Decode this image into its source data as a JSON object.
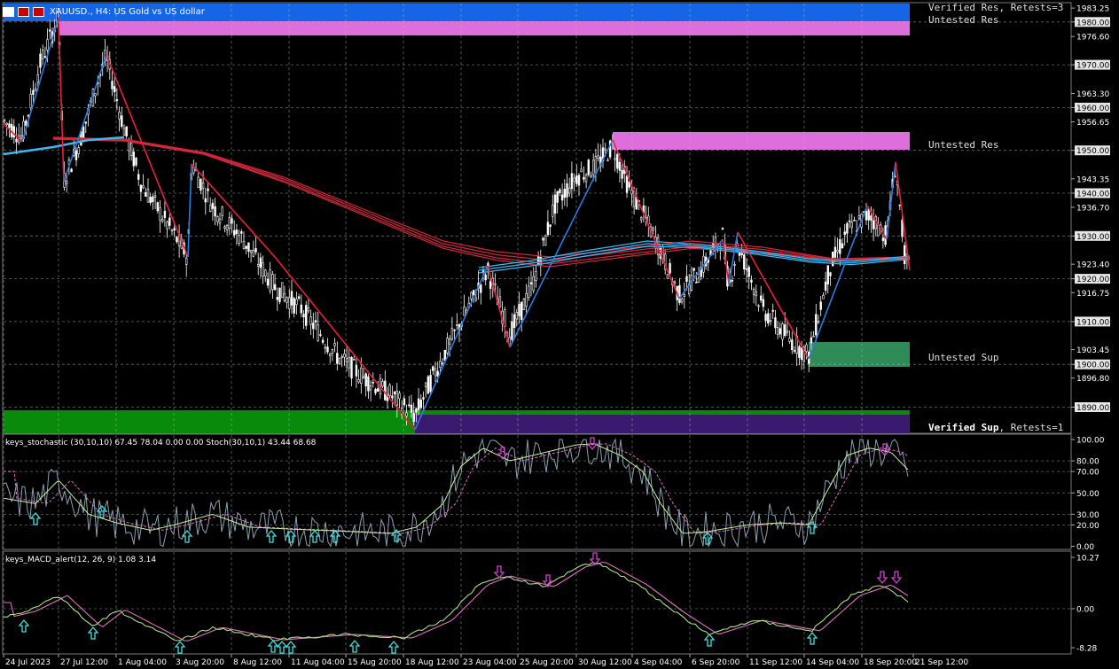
{
  "chart_header": {
    "symbol": "XAUUSD.",
    "timeframe": "H4",
    "description": "US Gold vs US dollar"
  },
  "zones": {
    "verified_res": "Verified Res, Retests=3",
    "untested_res_top": "Untested Res",
    "untested_res_mid": "Untested Res",
    "untested_sup": "Untested Sup",
    "verified_sup_bold": "Verified Sup",
    "verified_sup_rest": ", Retests=1"
  },
  "price_axis": [
    "1983.25",
    "1980.00",
    "1976.60",
    "1970.00",
    "1963.30",
    "1960.00",
    "1956.65",
    "1950.00",
    "1943.35",
    "1940.00",
    "1936.70",
    "1930.00",
    "1923.40",
    "1920.00",
    "1916.75",
    "1910.00",
    "1903.45",
    "1900.00",
    "1896.80",
    "1890.00"
  ],
  "highlighted_prices": [
    "1980.00",
    "1970.00",
    "1960.00",
    "1950.00",
    "1940.00",
    "1930.00",
    "1920.00",
    "1910.00",
    "1900.00",
    "1890.00"
  ],
  "stoch_panel": {
    "label": "keys_stochastic (30,10,10) 67.45 78.04 0.00 0.00 Stoch(30,10,1) 43.44 68.68",
    "axis": [
      "100.00",
      "80.00",
      "70.00",
      "50.00",
      "30.00",
      "20.00",
      "0.00"
    ]
  },
  "macd_panel": {
    "label": "keys_MACD_alert(12, 26, 9) 1.08 3.14",
    "axis": [
      "10.27",
      "0.00",
      "-8.28"
    ]
  },
  "time_axis": [
    "24 Jul 2023",
    "27 Jul 12:00",
    "1 Aug 04:00",
    "3 Aug 20:00",
    "8 Aug 12:00",
    "11 Aug 04:00",
    "15 Aug 20:00",
    "18 Aug 12:00",
    "23 Aug 04:00",
    "25 Aug 20:00",
    "30 Aug 12:00",
    "4 Sep 04:00",
    "6 Sep 20:00",
    "11 Sep 12:00",
    "14 Sep 04:00",
    "18 Sep 20:00",
    "21 Sep 12:00"
  ],
  "colors": {
    "background": "#000000",
    "verified_res_zone": "#1565e6",
    "untested_res_zone": "#dd6edc",
    "untested_sup_zone": "#2e8b57",
    "verified_sup_green": "#0a8a0a",
    "verified_sup_purple": "#3a1a6e",
    "zigzag_down": "#e8203c",
    "zigzag_up": "#2a7be0",
    "ma_red": "#d0283a",
    "ma_blue": "#3fb7ef",
    "up_arrow": "#40e0e0",
    "down_arrow": "#d040d0"
  }
}
